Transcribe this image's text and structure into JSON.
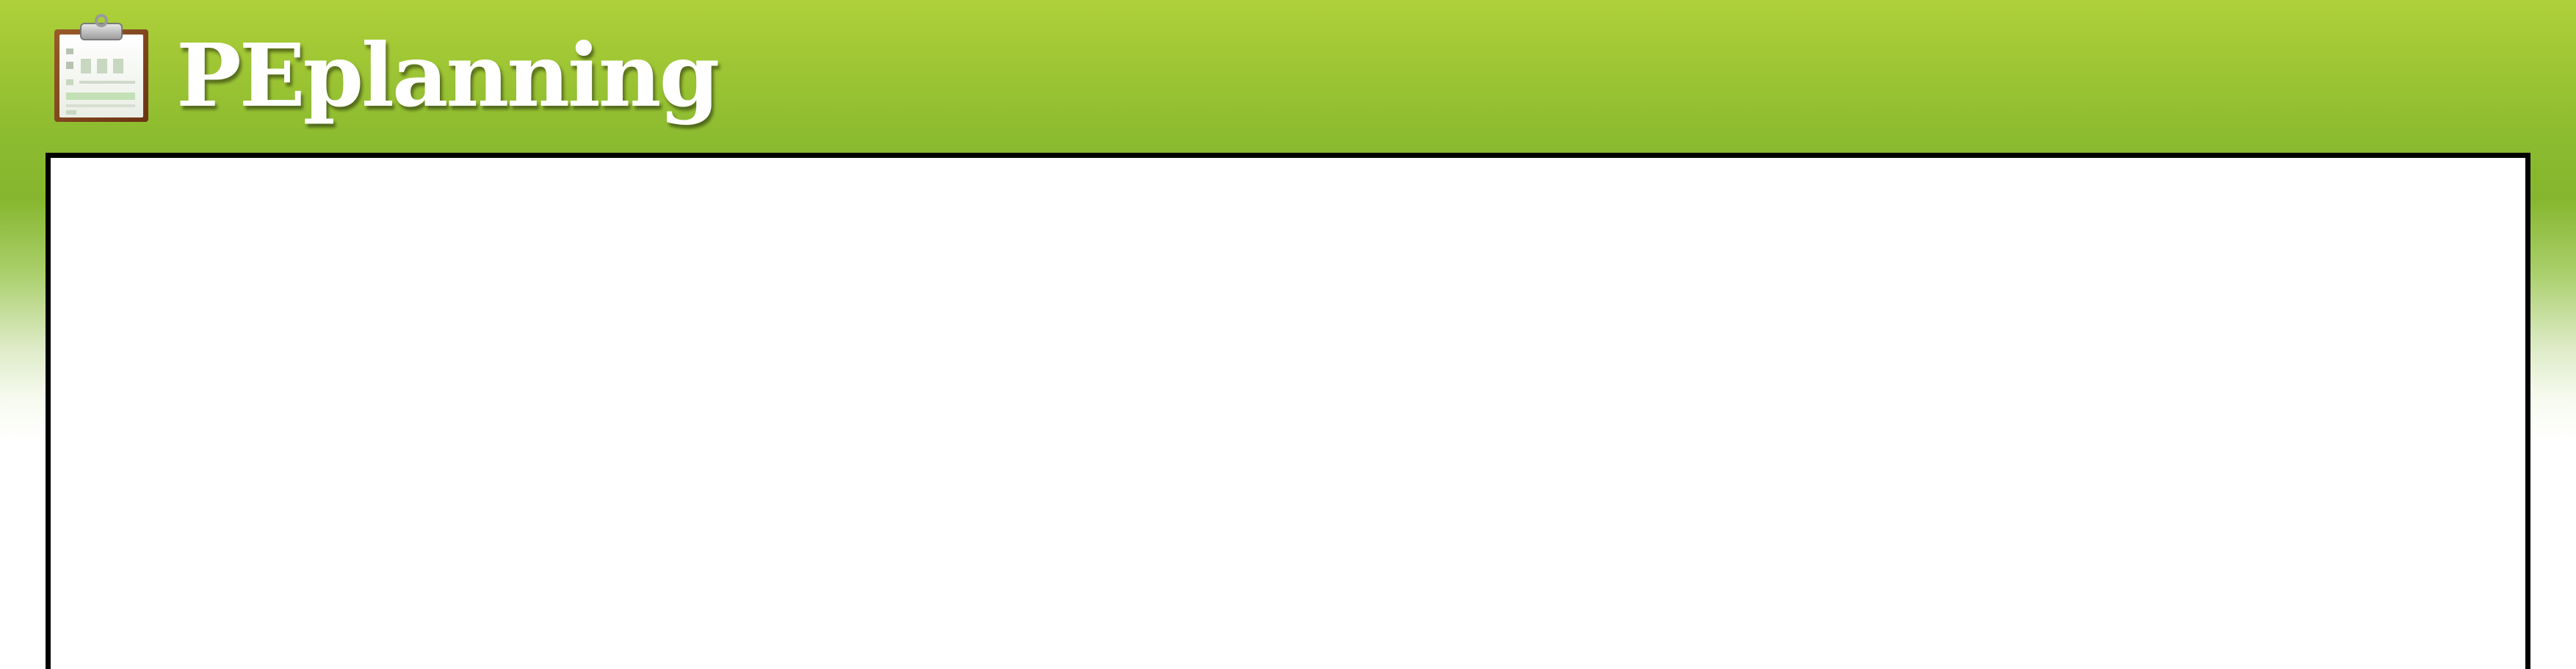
{
  "header": {
    "brand": "PEplanning",
    "logo_icon": "clipboard-icon"
  },
  "colors": {
    "header_green_top": "#aed13a",
    "header_green_bottom": "#86b62e",
    "brand_text": "#ffffff",
    "panel_border": "#000000",
    "panel_background": "#ffffff"
  },
  "main": {
    "panel_content": ""
  }
}
